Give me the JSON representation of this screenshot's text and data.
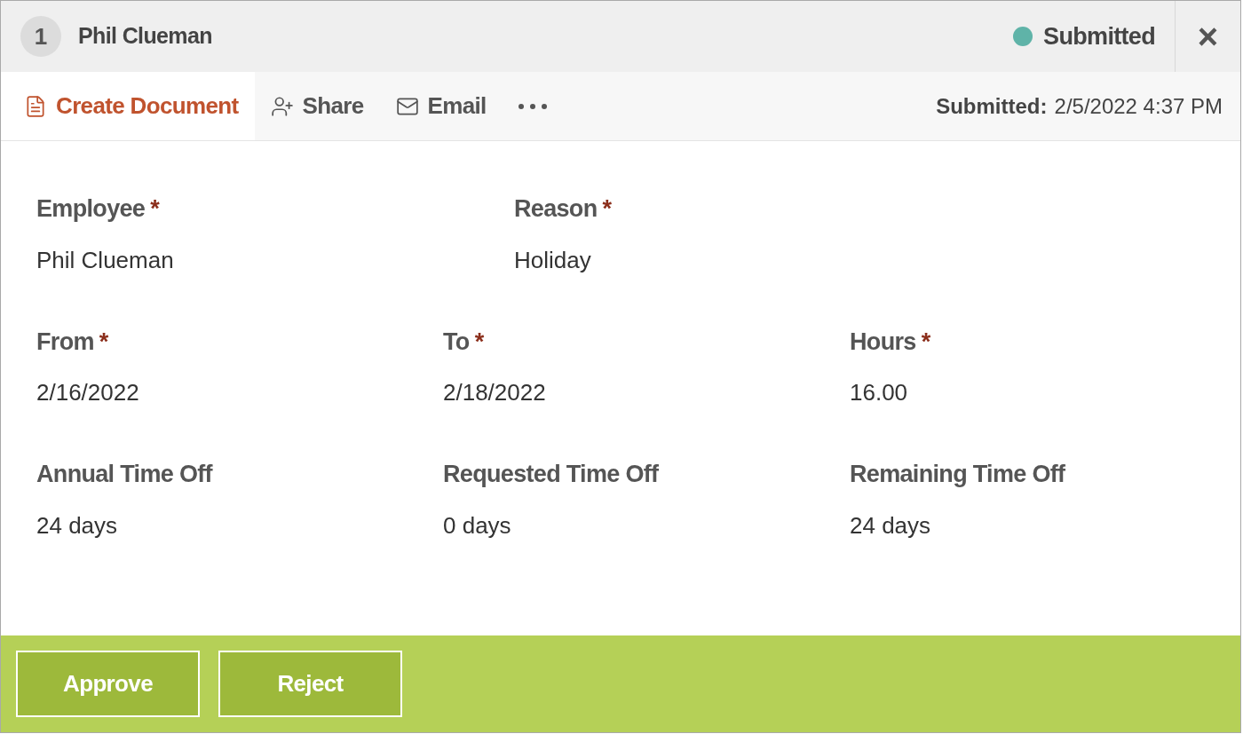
{
  "header": {
    "number": "1",
    "name": "Phil Clueman",
    "status": {
      "label": "Submitted",
      "color": "#5fb3a8"
    },
    "close": "×"
  },
  "toolbar": {
    "items": [
      {
        "kind": "pdf",
        "label": "Create Document",
        "selected": true
      },
      {
        "kind": "share",
        "label": "Share",
        "selected": false
      },
      {
        "kind": "email",
        "label": "Email",
        "selected": false
      },
      {
        "kind": "more",
        "selected": false
      }
    ],
    "submitted": {
      "label": "Submitted:",
      "value": "2/5/2022 4:37 PM"
    }
  },
  "required_mark": "*",
  "rows": [
    [
      {
        "label": "Employee",
        "required": true,
        "value": "Phil Clueman"
      },
      {
        "label": "Reason",
        "required": true,
        "value": "Holiday"
      }
    ],
    [
      {
        "label": "From",
        "required": true,
        "value": "2/16/2022"
      },
      {
        "label": "To",
        "required": true,
        "value": "2/18/2022"
      },
      {
        "label": "Hours",
        "required": true,
        "value": "16.00"
      }
    ],
    [
      {
        "label": "Annual Time Off",
        "required": false,
        "value": "24 days"
      },
      {
        "label": "Requested Time Off",
        "required": false,
        "value": "0 days"
      },
      {
        "label": "Remaining Time Off",
        "required": false,
        "value": "24 days"
      }
    ]
  ],
  "buttons": [
    "Approve",
    "Reject"
  ]
}
